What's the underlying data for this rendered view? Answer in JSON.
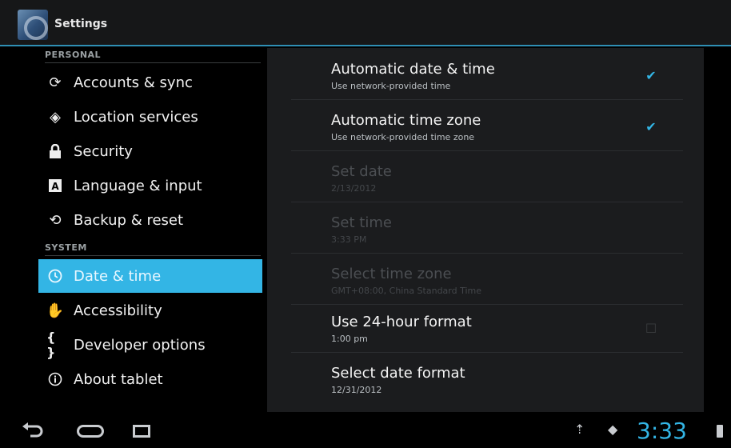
{
  "action_bar": {
    "title": "Settings",
    "app_icon": "settings-app-icon"
  },
  "sidebar": {
    "sections": [
      {
        "header": "PERSONAL",
        "items": [
          {
            "label": "Accounts & sync",
            "icon": "sync-icon"
          },
          {
            "label": "Location services",
            "icon": "location-icon"
          },
          {
            "label": "Security",
            "icon": "lock-icon"
          },
          {
            "label": "Language & input",
            "icon": "keyboard-icon"
          },
          {
            "label": "Backup & reset",
            "icon": "restore-icon"
          }
        ]
      },
      {
        "header": "SYSTEM",
        "items": [
          {
            "label": "Date & time",
            "icon": "clock-icon",
            "selected": true
          },
          {
            "label": "Accessibility",
            "icon": "hand-icon"
          },
          {
            "label": "Developer options",
            "icon": "braces-icon"
          },
          {
            "label": "About tablet",
            "icon": "info-icon"
          }
        ]
      }
    ]
  },
  "detail": {
    "prefs": [
      {
        "title": "Automatic date & time",
        "summary": "Use network-provided time",
        "checked": true,
        "enabled": true
      },
      {
        "title": "Automatic time zone",
        "summary": "Use network-provided time zone",
        "checked": true,
        "enabled": true
      },
      {
        "title": "Set date",
        "summary": "2/13/2012",
        "enabled": false
      },
      {
        "title": "Set time",
        "summary": "3:33 PM",
        "enabled": false
      },
      {
        "title": "Select time zone",
        "summary": "GMT+08:00, China Standard Time",
        "enabled": false
      },
      {
        "title": "Use 24-hour format",
        "summary": "1:00 pm",
        "checked": false,
        "enabled": true
      },
      {
        "title": "Select date format",
        "summary": "12/31/2012",
        "enabled": true
      }
    ]
  },
  "system_bar": {
    "clock": "3:33",
    "icons": [
      "back-icon",
      "home-icon",
      "recent-apps-icon",
      "usb-icon",
      "sync-status-icon",
      "battery-icon"
    ],
    "accent_color": "#33b5e5"
  }
}
